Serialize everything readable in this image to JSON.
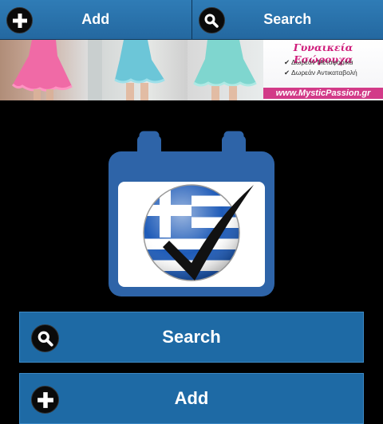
{
  "top_bar": {
    "add_label": "Add",
    "search_label": "Search"
  },
  "banner": {
    "title": "Γυναικεία Εσώρουχα",
    "line1": "✔ Δωρεάν Μεταφορικά",
    "line2": "✔ Δωρεάν Αντικαταβολή",
    "url": "www.MysticPassion.gr"
  },
  "main": {
    "search_label": "Search",
    "add_label": "Add"
  },
  "colors": {
    "button_blue": "#1e6aa5",
    "background": "#000000",
    "calendar_blue": "#2e64a8"
  }
}
